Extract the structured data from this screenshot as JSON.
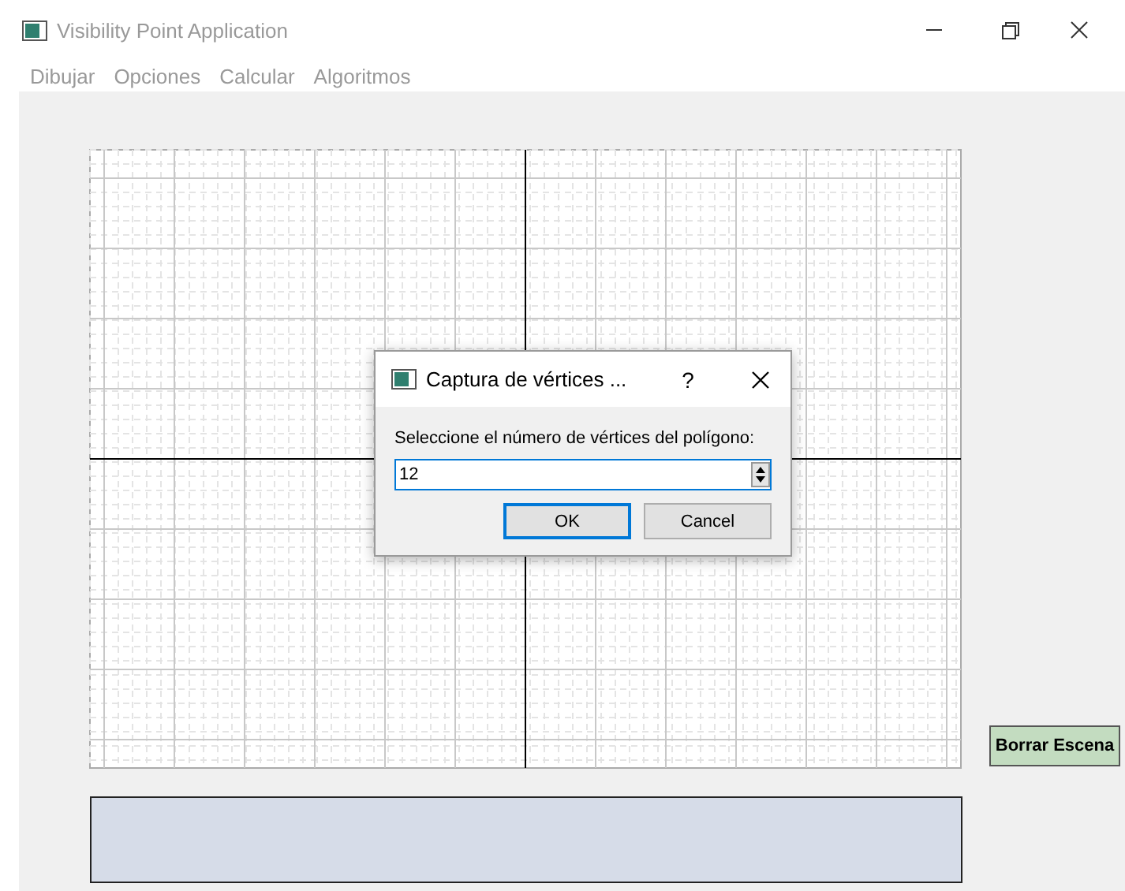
{
  "window": {
    "title": "Visibility Point Application"
  },
  "menu": [
    "Dibujar",
    "Opciones",
    "Calcular",
    "Algoritmos"
  ],
  "dialog": {
    "title": "Captura de vértices ...",
    "help": "?",
    "prompt": "Seleccione el número de vértices del polígono:",
    "value": "12",
    "buttons": [
      {
        "label": "OK",
        "default": true
      },
      {
        "label": "Cancel",
        "default": false
      }
    ]
  },
  "side_button": "Borrar Escena"
}
